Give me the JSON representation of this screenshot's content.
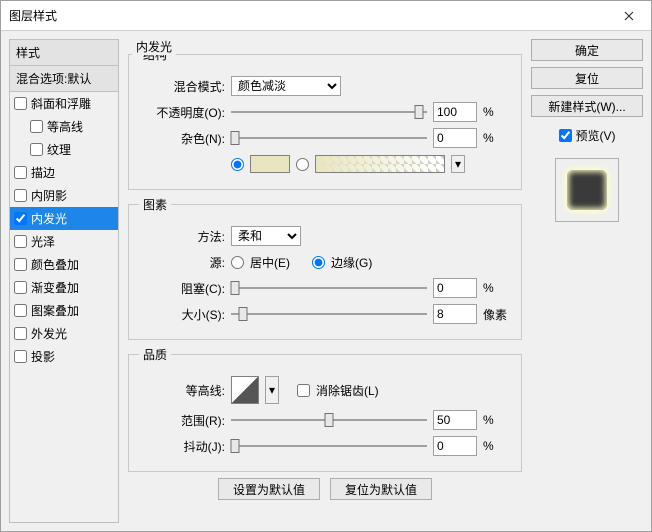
{
  "title": "图层样式",
  "left": {
    "header": "样式",
    "subheader": "混合选项:默认",
    "items": [
      {
        "label": "斜面和浮雕",
        "indent": false,
        "checked": false,
        "selected": false
      },
      {
        "label": "等高线",
        "indent": true,
        "checked": false,
        "selected": false
      },
      {
        "label": "纹理",
        "indent": true,
        "checked": false,
        "selected": false
      },
      {
        "label": "描边",
        "indent": false,
        "checked": false,
        "selected": false
      },
      {
        "label": "内阴影",
        "indent": false,
        "checked": false,
        "selected": false
      },
      {
        "label": "内发光",
        "indent": false,
        "checked": true,
        "selected": true
      },
      {
        "label": "光泽",
        "indent": false,
        "checked": false,
        "selected": false
      },
      {
        "label": "颜色叠加",
        "indent": false,
        "checked": false,
        "selected": false
      },
      {
        "label": "渐变叠加",
        "indent": false,
        "checked": false,
        "selected": false
      },
      {
        "label": "图案叠加",
        "indent": false,
        "checked": false,
        "selected": false
      },
      {
        "label": "外发光",
        "indent": false,
        "checked": false,
        "selected": false
      },
      {
        "label": "投影",
        "indent": false,
        "checked": false,
        "selected": false
      }
    ]
  },
  "panel": {
    "title": "内发光",
    "structure": {
      "legend": "结构",
      "blend_label": "混合模式:",
      "blend_value": "颜色减淡",
      "opacity_label": "不透明度(O):",
      "opacity_value": "100",
      "opacity_unit": "%",
      "noise_label": "杂色(N):",
      "noise_value": "0",
      "noise_unit": "%",
      "swatch_color": "#e8e6c0"
    },
    "elements": {
      "legend": "图素",
      "method_label": "方法:",
      "method_value": "柔和",
      "source_label": "源:",
      "source_center": "居中(E)",
      "source_edge": "边缘(G)",
      "choke_label": "阻塞(C):",
      "choke_value": "0",
      "choke_unit": "%",
      "size_label": "大小(S):",
      "size_value": "8",
      "size_unit": "像素"
    },
    "quality": {
      "legend": "品质",
      "contour_label": "等高线:",
      "antialias_label": "消除锯齿(L)",
      "range_label": "范围(R):",
      "range_value": "50",
      "range_unit": "%",
      "jitter_label": "抖动(J):",
      "jitter_value": "0",
      "jitter_unit": "%"
    },
    "reset_btn": "设置为默认值",
    "revert_btn": "复位为默认值"
  },
  "right": {
    "ok": "确定",
    "cancel": "复位",
    "newstyle": "新建样式(W)...",
    "preview": "预览(V)"
  }
}
